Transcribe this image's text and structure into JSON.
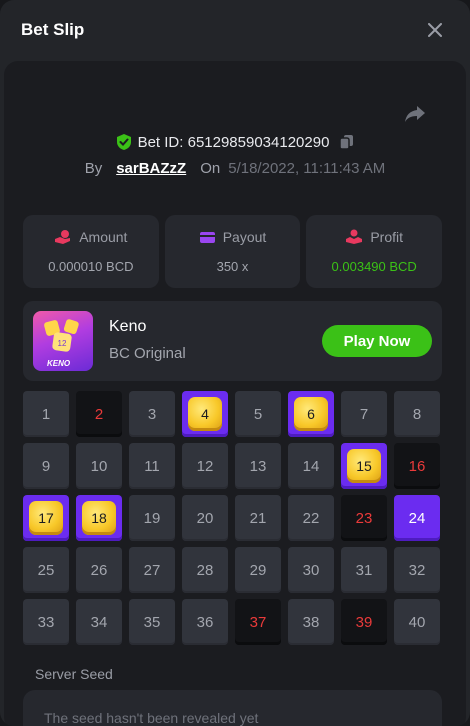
{
  "header": {
    "title": "Bet Slip"
  },
  "bet": {
    "id_text": "Bet ID: 65129859034120290",
    "by_label": "By",
    "user": "sarBAZzZ",
    "on_label": "On",
    "date": "5/18/2022, 11:11:43 AM"
  },
  "stats": [
    {
      "label": "Amount",
      "value": "0.000010 BCD",
      "icon": "coin-hand-icon"
    },
    {
      "label": "Payout",
      "value": "350 x",
      "icon": "wallet-icon"
    },
    {
      "label": "Profit",
      "value": "0.003490 BCD",
      "icon": "profit-hand-icon"
    }
  ],
  "game": {
    "name": "Keno",
    "subtitle": "BC Original",
    "thumb_label": "KENO",
    "play_label": "Play Now"
  },
  "tiles": [
    {
      "n": "1",
      "s": "normal"
    },
    {
      "n": "2",
      "s": "drawn"
    },
    {
      "n": "3",
      "s": "normal"
    },
    {
      "n": "4",
      "s": "hit"
    },
    {
      "n": "5",
      "s": "normal"
    },
    {
      "n": "6",
      "s": "hit"
    },
    {
      "n": "7",
      "s": "normal"
    },
    {
      "n": "8",
      "s": "normal"
    },
    {
      "n": "9",
      "s": "normal"
    },
    {
      "n": "10",
      "s": "normal"
    },
    {
      "n": "11",
      "s": "normal"
    },
    {
      "n": "12",
      "s": "normal"
    },
    {
      "n": "13",
      "s": "normal"
    },
    {
      "n": "14",
      "s": "normal"
    },
    {
      "n": "15",
      "s": "hit"
    },
    {
      "n": "16",
      "s": "drawn"
    },
    {
      "n": "17",
      "s": "hit"
    },
    {
      "n": "18",
      "s": "hit"
    },
    {
      "n": "19",
      "s": "normal"
    },
    {
      "n": "20",
      "s": "normal"
    },
    {
      "n": "21",
      "s": "normal"
    },
    {
      "n": "22",
      "s": "normal"
    },
    {
      "n": "23",
      "s": "drawn"
    },
    {
      "n": "24",
      "s": "picked"
    },
    {
      "n": "25",
      "s": "normal"
    },
    {
      "n": "26",
      "s": "normal"
    },
    {
      "n": "27",
      "s": "normal"
    },
    {
      "n": "28",
      "s": "normal"
    },
    {
      "n": "29",
      "s": "normal"
    },
    {
      "n": "30",
      "s": "normal"
    },
    {
      "n": "31",
      "s": "normal"
    },
    {
      "n": "32",
      "s": "normal"
    },
    {
      "n": "33",
      "s": "normal"
    },
    {
      "n": "34",
      "s": "normal"
    },
    {
      "n": "35",
      "s": "normal"
    },
    {
      "n": "36",
      "s": "normal"
    },
    {
      "n": "37",
      "s": "drawn"
    },
    {
      "n": "38",
      "s": "normal"
    },
    {
      "n": "39",
      "s": "drawn"
    },
    {
      "n": "40",
      "s": "normal"
    }
  ],
  "seed": {
    "label": "Server Seed",
    "text": "The seed hasn't been revealed yet"
  },
  "colors": {
    "accent_green": "#3bc117",
    "pick_purple": "#6b2cf0",
    "drawn_red": "#ea3a3a",
    "gem_gold": "#f8c829"
  }
}
